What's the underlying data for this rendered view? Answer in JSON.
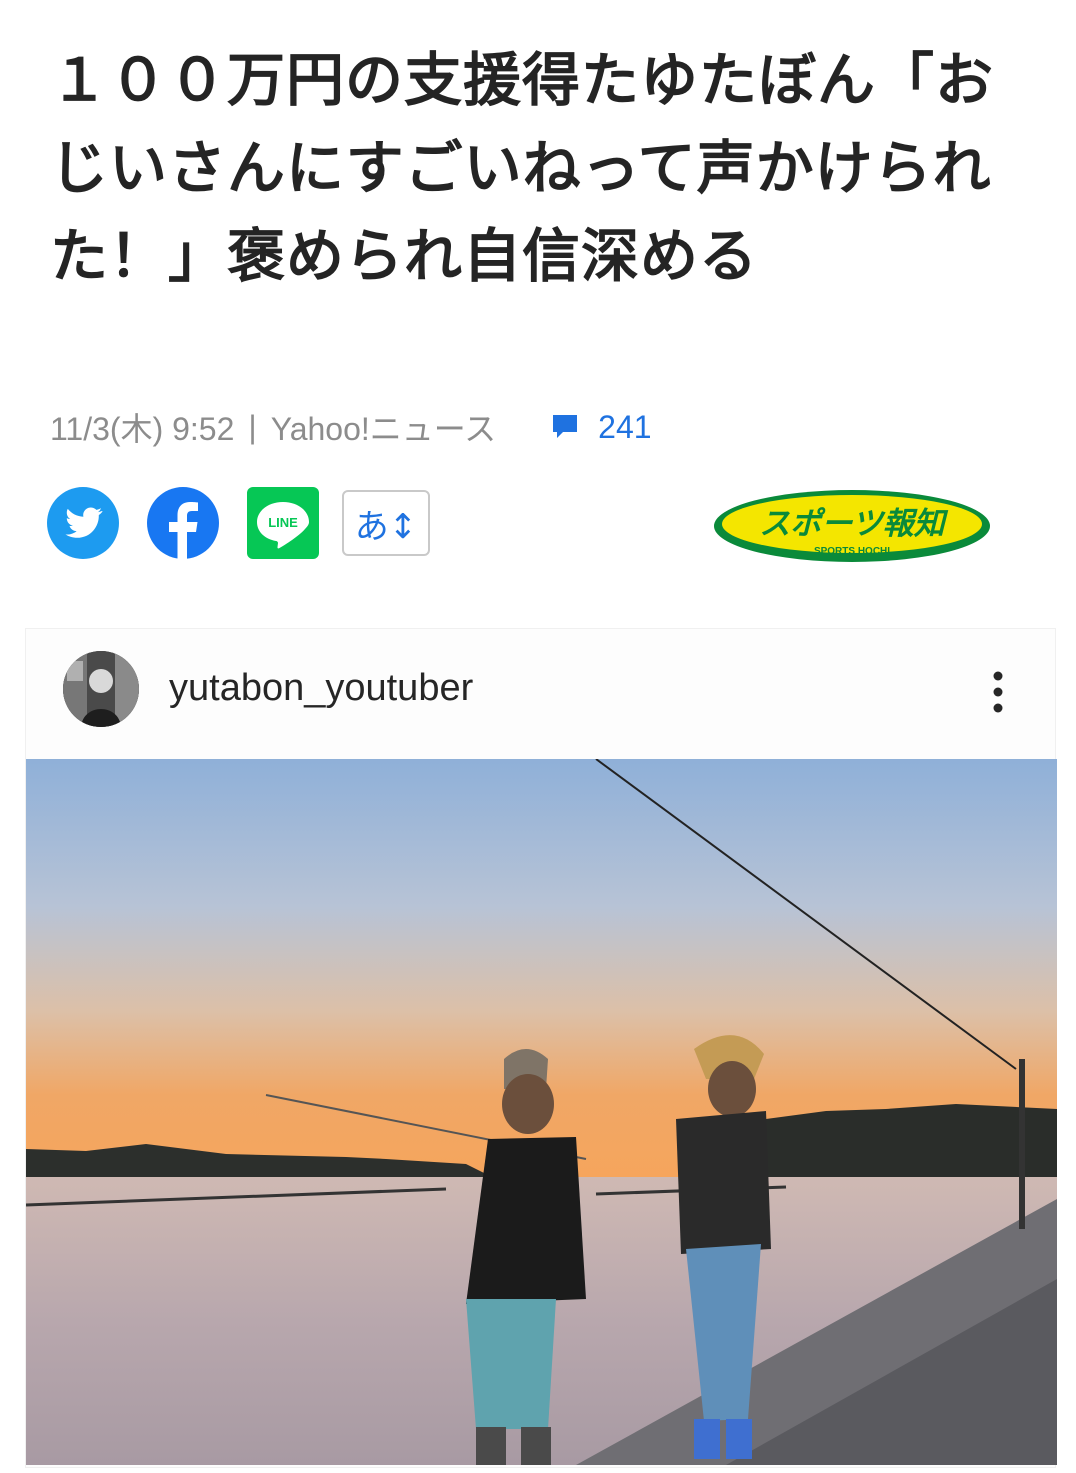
{
  "article": {
    "title": "１００万円の支援得たゆたぼん「おじいさんにすごいねって声かけられた！」褒められ自信深める",
    "date": "11/3(木) 9:52",
    "separator": "|",
    "source": "Yahoo!ニュース",
    "comment_count": "241"
  },
  "share": {
    "twitter_icon": "twitter-bird-icon",
    "facebook_icon": "facebook-f-icon",
    "line_icon": "line-chat-icon",
    "line_label": "LINE",
    "font_size_label": "あ↕"
  },
  "publisher": {
    "logo_text": "スポーツ報知",
    "logo_subtext": "SPORTS HOCHI"
  },
  "instagram": {
    "username": "yutabon_youtuber",
    "more_icon": "vertical-ellipsis-icon"
  },
  "colors": {
    "accent_blue": "#1f72e0",
    "twitter": "#1d9bf0",
    "facebook": "#1877f2",
    "line": "#06c755",
    "hochi_yellow": "#f4e600",
    "hochi_green": "#0a8a3a"
  }
}
